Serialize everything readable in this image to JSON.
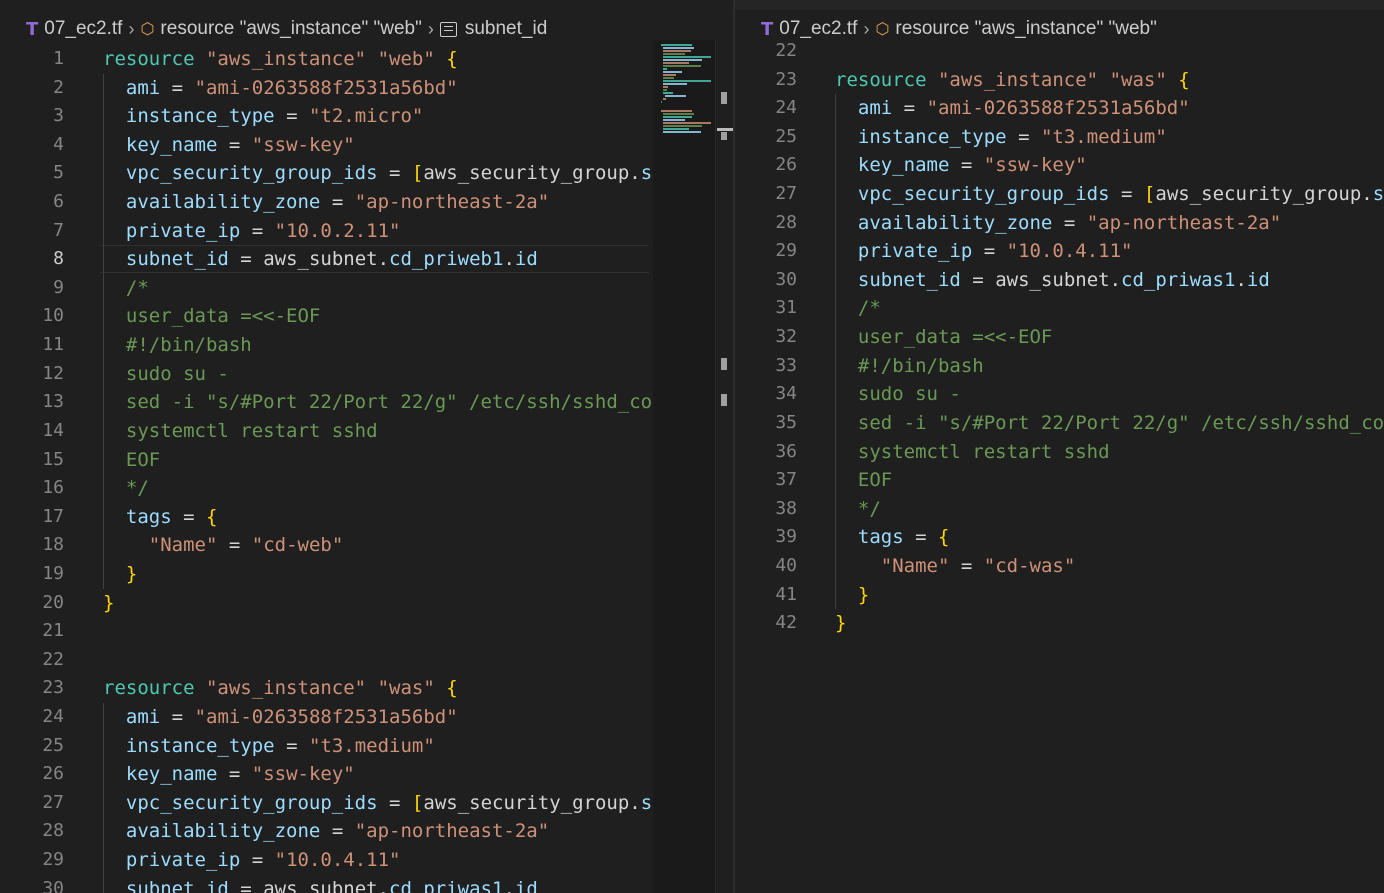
{
  "left_pane": {
    "breadcrumb": {
      "file": "07_ec2.tf",
      "resource": "resource \"aws_instance\" \"web\"",
      "property": "subnet_id"
    },
    "active_line": 8,
    "lines": [
      {
        "n": "1",
        "t": "resource \"aws_instance\" \"web\" {"
      },
      {
        "n": "2",
        "t": "  ami = \"ami-0263588f2531a56bd\""
      },
      {
        "n": "3",
        "t": "  instance_type = \"t2.micro\""
      },
      {
        "n": "4",
        "t": "  key_name = \"ssw-key\""
      },
      {
        "n": "5",
        "t": "  vpc_security_group_ids = [aws_security_group.s"
      },
      {
        "n": "6",
        "t": "  availability_zone = \"ap-northeast-2a\""
      },
      {
        "n": "7",
        "t": "  private_ip = \"10.0.2.11\""
      },
      {
        "n": "8",
        "t": "  subnet_id = aws_subnet.cd_priweb1.id"
      },
      {
        "n": "9",
        "t": "  /*"
      },
      {
        "n": "10",
        "t": "  user_data =<<-EOF"
      },
      {
        "n": "11",
        "t": "  #!/bin/bash"
      },
      {
        "n": "12",
        "t": "  sudo su -"
      },
      {
        "n": "13",
        "t": "  sed -i \"s/#Port 22/Port 22/g\" /etc/ssh/sshd_co"
      },
      {
        "n": "14",
        "t": "  systemctl restart sshd"
      },
      {
        "n": "15",
        "t": "  EOF"
      },
      {
        "n": "16",
        "t": "  */"
      },
      {
        "n": "17",
        "t": "  tags = {"
      },
      {
        "n": "18",
        "t": "    \"Name\" = \"cd-web\""
      },
      {
        "n": "19",
        "t": "  }"
      },
      {
        "n": "20",
        "t": "}"
      },
      {
        "n": "21",
        "t": ""
      },
      {
        "n": "22",
        "t": ""
      },
      {
        "n": "23",
        "t": "resource \"aws_instance\" \"was\" {"
      },
      {
        "n": "24",
        "t": "  ami = \"ami-0263588f2531a56bd\""
      },
      {
        "n": "25",
        "t": "  instance_type = \"t3.medium\""
      },
      {
        "n": "26",
        "t": "  key_name = \"ssw-key\""
      },
      {
        "n": "27",
        "t": "  vpc_security_group_ids = [aws_security_group.s"
      },
      {
        "n": "28",
        "t": "  availability_zone = \"ap-northeast-2a\""
      },
      {
        "n": "29",
        "t": "  private_ip = \"10.0.4.11\""
      },
      {
        "n": "30",
        "t": "  subnet_id = aws_subnet.cd_priwas1.id"
      }
    ]
  },
  "right_pane": {
    "breadcrumb": {
      "file": "07_ec2.tf",
      "resource": "resource \"aws_instance\" \"web\""
    },
    "lines": [
      {
        "n": "22",
        "t": ""
      },
      {
        "n": "23",
        "t": "resource \"aws_instance\" \"was\" {"
      },
      {
        "n": "24",
        "t": "  ami = \"ami-0263588f2531a56bd\""
      },
      {
        "n": "25",
        "t": "  instance_type = \"t3.medium\""
      },
      {
        "n": "26",
        "t": "  key_name = \"ssw-key\""
      },
      {
        "n": "27",
        "t": "  vpc_security_group_ids = [aws_security_group.s"
      },
      {
        "n": "28",
        "t": "  availability_zone = \"ap-northeast-2a\""
      },
      {
        "n": "29",
        "t": "  private_ip = \"10.0.4.11\""
      },
      {
        "n": "30",
        "t": "  subnet_id = aws_subnet.cd_priwas1.id"
      },
      {
        "n": "31",
        "t": "  /*"
      },
      {
        "n": "32",
        "t": "  user_data =<<-EOF"
      },
      {
        "n": "33",
        "t": "  #!/bin/bash"
      },
      {
        "n": "34",
        "t": "  sudo su -"
      },
      {
        "n": "35",
        "t": "  sed -i \"s/#Port 22/Port 22/g\" /etc/ssh/sshd_co"
      },
      {
        "n": "36",
        "t": "  systemctl restart sshd"
      },
      {
        "n": "37",
        "t": "  EOF"
      },
      {
        "n": "38",
        "t": "  */"
      },
      {
        "n": "39",
        "t": "  tags = {"
      },
      {
        "n": "40",
        "t": "    \"Name\" = \"cd-was\""
      },
      {
        "n": "41",
        "t": "  }"
      },
      {
        "n": "42",
        "t": "}"
      }
    ]
  },
  "colors": {
    "background": "#1f1f1f",
    "keyword": "#4ec9b0",
    "string": "#ce9178",
    "property": "#9cdcfe",
    "comment": "#6a9955",
    "bracket": "#ffd700"
  }
}
